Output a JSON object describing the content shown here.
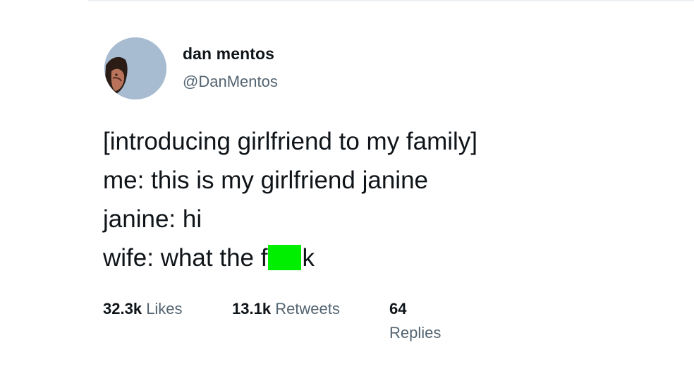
{
  "tweet": {
    "author_name": "dan mentos",
    "author_handle": "@DanMentos",
    "lines": {
      "l1": "[introducing girlfriend to my family]",
      "l2": "me: this is my girlfriend janine",
      "l3": "janine: hi",
      "l4_prefix": "wife: what the f",
      "l4_suffix": "k"
    },
    "censor_color": "#00ee00"
  },
  "stats": {
    "likes_count": "32.3k",
    "likes_label": "Likes",
    "retweets_count": "13.1k",
    "retweets_label": "Retweets",
    "replies_count": "64",
    "replies_label": "Replies"
  },
  "colors": {
    "text": "#0f1419",
    "muted": "#536471",
    "avatar_bg": "#a3b8cf"
  },
  "icons": {
    "avatar": "profile-photo"
  }
}
